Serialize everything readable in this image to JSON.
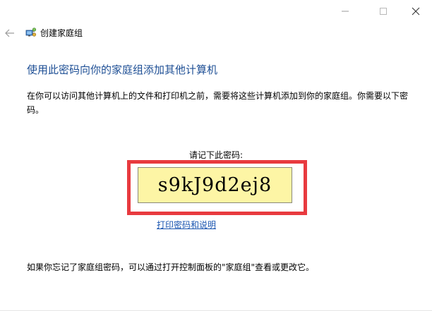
{
  "window": {
    "controls": [
      {
        "name": "minimize",
        "icon": "minimize-icon"
      },
      {
        "name": "maximize",
        "icon": "maximize-icon"
      },
      {
        "name": "close",
        "icon": "close-icon"
      }
    ]
  },
  "nav": {
    "back_icon": "back-arrow-icon",
    "app_icon": "homegroup-icon",
    "title": "创建家庭组"
  },
  "content": {
    "heading": "使用此密码向你的家庭组添加其他计算机",
    "description": "在你可以访问其他计算机上的文件和打印机之前，需要将这些计算机添加到你的家庭组。你需要以下密码。",
    "password_label": "请记下此密码:",
    "password": "s9kJ9d2ej8",
    "print_link": "打印密码和说明",
    "footer_note": "如果你忘记了家庭组密码，可以通过打开控制面板的\"家庭组\"查看或更改它。"
  },
  "colors": {
    "heading": "#1e4f95",
    "link": "#1a55b0",
    "password_bg": "#fdf5a5",
    "highlight": "#e83a3f"
  }
}
